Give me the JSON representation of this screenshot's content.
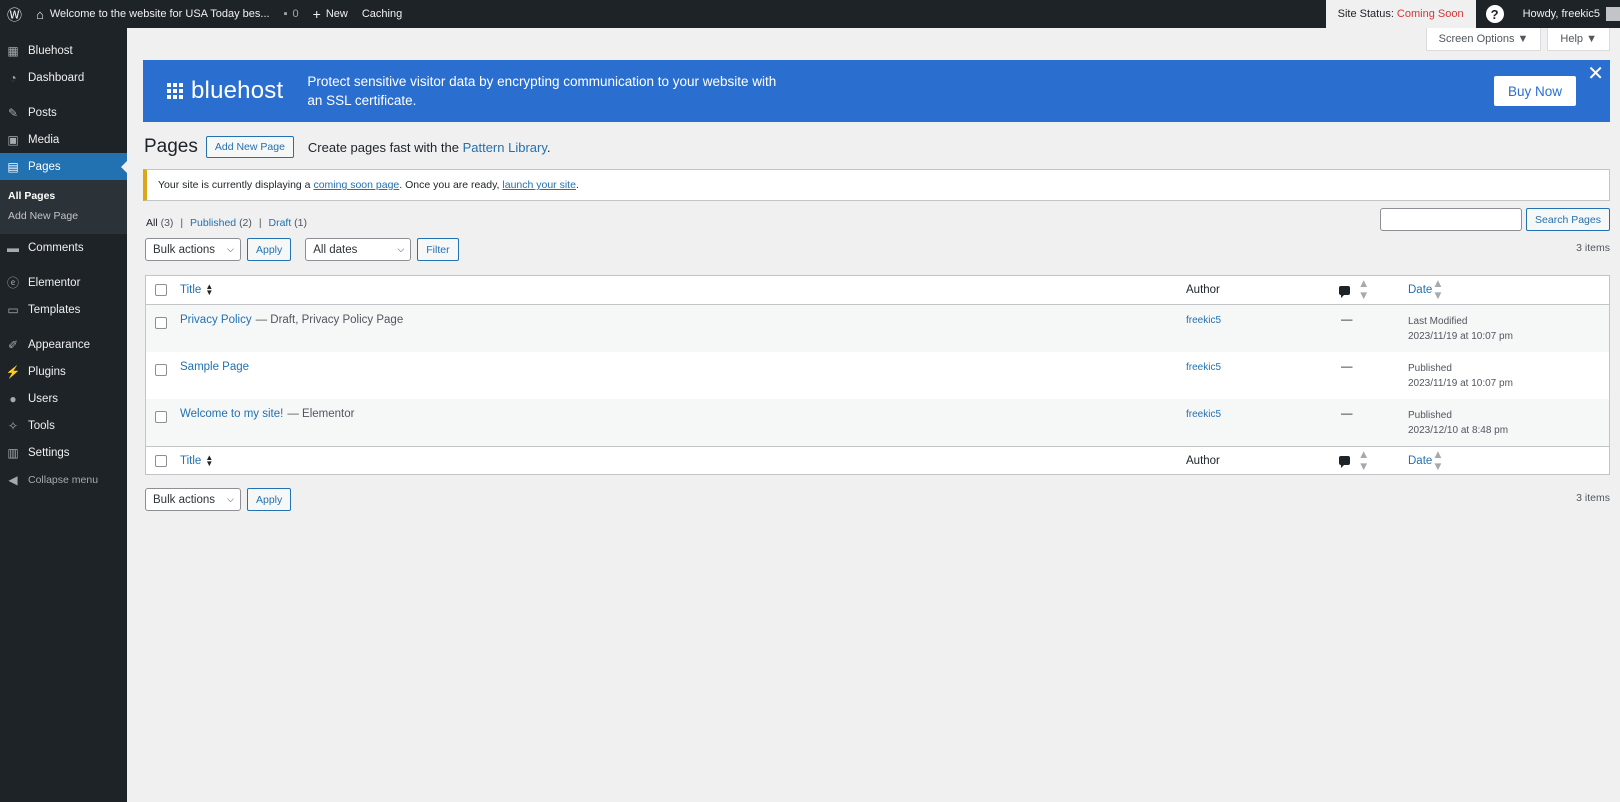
{
  "adminbar": {
    "site_name": "Welcome to the website for USA Today bes...",
    "comments_count": "0",
    "new_label": "New",
    "caching_label": "Caching",
    "site_status_label": "Site Status:",
    "site_status_value": "Coming Soon",
    "howdy": "Howdy, freekic5"
  },
  "sidebar": {
    "items": [
      {
        "label": "Bluehost",
        "icon": "grid-icon"
      },
      {
        "label": "Dashboard",
        "icon": "dashboard-icon"
      },
      {
        "label": "Posts",
        "icon": "pin-icon"
      },
      {
        "label": "Media",
        "icon": "media-icon"
      },
      {
        "label": "Pages",
        "icon": "pages-icon"
      },
      {
        "label": "Comments",
        "icon": "comment-icon"
      },
      {
        "label": "Elementor",
        "icon": "elementor-icon"
      },
      {
        "label": "Templates",
        "icon": "folder-icon"
      },
      {
        "label": "Appearance",
        "icon": "brush-icon"
      },
      {
        "label": "Plugins",
        "icon": "plug-icon"
      },
      {
        "label": "Users",
        "icon": "user-icon"
      },
      {
        "label": "Tools",
        "icon": "wrench-icon"
      },
      {
        "label": "Settings",
        "icon": "settings-icon"
      },
      {
        "label": "Collapse menu",
        "icon": "collapse-icon"
      }
    ],
    "submenu": [
      "All Pages",
      "Add New Page"
    ]
  },
  "screen_options": "Screen Options ▼",
  "help": "Help ▼",
  "banner": {
    "logo": "bluehost",
    "message": "Protect sensitive visitor data by encrypting communication to your website with an SSL certificate.",
    "buy": "Buy Now",
    "brand_color": "#2a6fd0"
  },
  "header": {
    "title": "Pages",
    "add_new": "Add New Page",
    "pattern_prefix": "Create pages fast with the",
    "pattern_link": "Pattern Library",
    "pattern_suffix": "."
  },
  "notice": {
    "prefix": "Your site is currently displaying a",
    "link1": "coming soon page",
    "middle": ". Once you are ready,",
    "link2": "launch your site",
    "suffix": "."
  },
  "filters": {
    "all": "All",
    "all_count": "(3)",
    "published": "Published",
    "published_count": "(2)",
    "draft": "Draft",
    "draft_count": "(1)",
    "sep": "|"
  },
  "search": {
    "button": "Search Pages"
  },
  "tablenav": {
    "bulk": "Bulk actions",
    "apply": "Apply",
    "dates": "All dates",
    "filter": "Filter",
    "items": "3 items"
  },
  "table": {
    "columns": {
      "title": "Title",
      "author": "Author",
      "date": "Date"
    },
    "rows": [
      {
        "title": "Privacy Policy",
        "state": "— Draft, Privacy Policy Page",
        "author": "freekic5",
        "comments": "—",
        "date_status": "Last Modified",
        "date": "2023/11/19 at 10:07 pm"
      },
      {
        "title": "Sample Page",
        "state": "",
        "author": "freekic5",
        "comments": "—",
        "date_status": "Published",
        "date": "2023/11/19 at 10:07 pm"
      },
      {
        "title": "Welcome to my site!",
        "state": "— Elementor",
        "author": "freekic5",
        "comments": "—",
        "date_status": "Published",
        "date": "2023/12/10 at 8:48 pm"
      }
    ]
  }
}
